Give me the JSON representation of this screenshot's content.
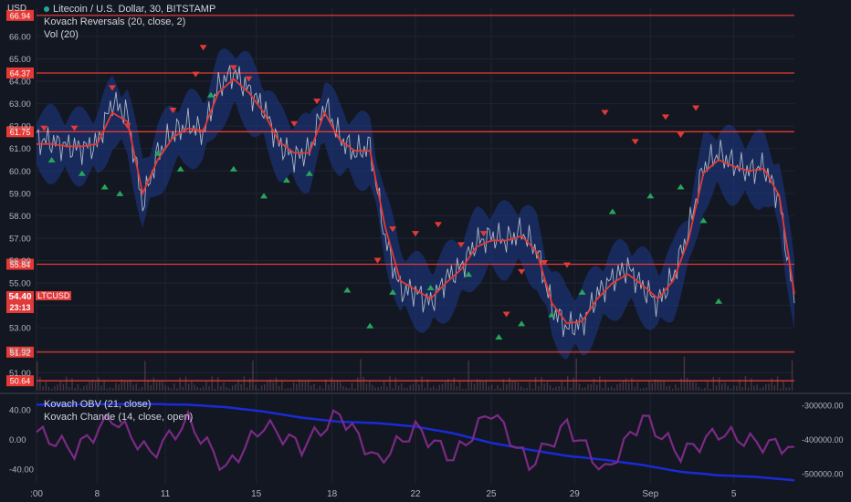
{
  "header": {
    "currency": "USD",
    "title": "Litecoin / U.S. Dollar, 30, BITSTAMP",
    "indicator1": "Kovach Reversals (20, close, 2)",
    "indicator2": "Vol (20)"
  },
  "lower_pane": {
    "indicator1": "Kovach OBV (21, close)",
    "indicator2": "Kovach Chande (14, close, open)"
  },
  "symbol_tag": "LTCUSD",
  "price_tag": "54.40",
  "countdown": "23:13",
  "colors": {
    "background": "#131722",
    "level_line": "#e53935",
    "channel": "#1e3a8a",
    "price": "#c8cfd6",
    "ma": "#e53935",
    "up_marker": "#26a65b",
    "down_marker": "#e53935",
    "obv": "#1a2bd6",
    "chande": "#7b2a84"
  },
  "chart_data": [
    {
      "type": "line",
      "title": "Litecoin / U.S. Dollar, 30, BITSTAMP",
      "yaxis_label": "USD",
      "ylim": [
        50.2,
        67.3
      ],
      "y_ticks": [
        "66.00",
        "65.00",
        "64.00",
        "63.00",
        "62.00",
        "61.00",
        "60.00",
        "59.00",
        "58.00",
        "57.00",
        "56.00",
        "55.00",
        "54.00",
        "53.00",
        "52.00",
        "51.00"
      ],
      "x_ticks": [
        ":00",
        "8",
        "11",
        "15",
        "18",
        "22",
        "25",
        "29",
        "Sep",
        "5"
      ],
      "levels": [
        {
          "value": 66.94,
          "label": "66.94"
        },
        {
          "value": 64.37,
          "label": "64.37"
        },
        {
          "value": 61.75,
          "label": "61.75"
        },
        {
          "value": 55.84,
          "label": "55.84"
        },
        {
          "value": 51.92,
          "label": "51.92"
        },
        {
          "value": 50.64,
          "label": "50.64"
        }
      ],
      "x": [
        0,
        2,
        4,
        6,
        8,
        10,
        12,
        14,
        16,
        18,
        20,
        22,
        24,
        26,
        28,
        30,
        32,
        34,
        36,
        38,
        40,
        42,
        44,
        46,
        48,
        50,
        52,
        54,
        56,
        58,
        60,
        62,
        64,
        66,
        68,
        70,
        72,
        74,
        76,
        78,
        80,
        82,
        84,
        86,
        88,
        90,
        92,
        94,
        96,
        98,
        100
      ],
      "series": [
        {
          "values": [
            61.4,
            61.3,
            61.1,
            61.0,
            61.2,
            63.1,
            62.5,
            58.5,
            60.8,
            61.7,
            62.1,
            61.7,
            63.8,
            64.4,
            63.6,
            62.8,
            61.2,
            60.6,
            60.9,
            63.0,
            61.5,
            60.8,
            61.1,
            57.0,
            54.7,
            54.6,
            54.1,
            55.2,
            55.7,
            56.8,
            57.1,
            56.9,
            57.3,
            56.5,
            53.9,
            53.0,
            53.2,
            54.5,
            55.2,
            55.7,
            54.8,
            54.1,
            55.3,
            57.3,
            60.2,
            60.8,
            60.3,
            60.0,
            60.2,
            58.7,
            54.1
          ]
        },
        {
          "values": [
            61.2,
            61.2,
            61.1,
            61.1,
            61.2,
            62.6,
            62.2,
            59.0,
            60.5,
            61.5,
            61.9,
            61.8,
            63.5,
            64.1,
            63.5,
            62.6,
            61.3,
            60.8,
            60.8,
            62.6,
            61.4,
            60.9,
            60.9,
            57.5,
            55.1,
            54.7,
            54.3,
            55.0,
            55.6,
            56.6,
            56.9,
            56.9,
            57.1,
            56.4,
            54.1,
            53.2,
            53.3,
            54.3,
            55.0,
            55.4,
            54.9,
            54.3,
            55.1,
            56.9,
            59.9,
            60.5,
            60.2,
            60.0,
            60.1,
            58.9,
            54.5
          ]
        }
      ],
      "reversal_markers": {
        "down": [
          [
            1,
            61.9
          ],
          [
            5,
            61.9
          ],
          [
            10,
            63.7
          ],
          [
            12,
            62.0
          ],
          [
            18,
            62.7
          ],
          [
            21,
            64.3
          ],
          [
            22,
            65.5
          ],
          [
            26,
            64.6
          ],
          [
            28,
            64.1
          ],
          [
            34,
            62.1
          ],
          [
            37,
            63.1
          ],
          [
            45,
            56.0
          ],
          [
            47,
            57.4
          ],
          [
            50,
            57.2
          ],
          [
            53,
            57.6
          ],
          [
            56,
            56.7
          ],
          [
            59,
            57.2
          ],
          [
            62,
            53.6
          ],
          [
            64,
            55.5
          ],
          [
            67,
            55.9
          ],
          [
            70,
            55.8
          ],
          [
            75,
            62.6
          ],
          [
            79,
            61.3
          ],
          [
            83,
            62.4
          ],
          [
            85,
            61.6
          ],
          [
            87,
            62.8
          ]
        ],
        "up": [
          [
            2,
            60.5
          ],
          [
            6,
            59.9
          ],
          [
            9,
            59.3
          ],
          [
            11,
            59.0
          ],
          [
            16,
            60.8
          ],
          [
            19,
            60.1
          ],
          [
            23,
            63.4
          ],
          [
            26,
            60.1
          ],
          [
            30,
            58.9
          ],
          [
            33,
            59.6
          ],
          [
            36,
            59.9
          ],
          [
            41,
            54.7
          ],
          [
            44,
            53.1
          ],
          [
            47,
            54.6
          ],
          [
            52,
            54.8
          ],
          [
            57,
            55.4
          ],
          [
            61,
            52.6
          ],
          [
            64,
            53.2
          ],
          [
            68,
            53.6
          ],
          [
            72,
            54.6
          ],
          [
            76,
            58.2
          ],
          [
            81,
            58.9
          ],
          [
            85,
            59.3
          ],
          [
            88,
            57.8
          ],
          [
            90,
            54.2
          ]
        ]
      }
    },
    {
      "type": "line",
      "title": "Kovach OBV (21, close) / Kovach Chande (14, close, open)",
      "left_ticks": [
        "40.00",
        "0.00",
        "-40.00"
      ],
      "right_ticks": [
        "-300000.00",
        "-400000.00",
        "-500000.00"
      ],
      "left_ylim": [
        -60,
        60
      ],
      "right_ylim": [
        -530000,
        -270000
      ],
      "x": [
        0,
        5,
        10,
        15,
        20,
        25,
        30,
        35,
        40,
        45,
        50,
        55,
        60,
        65,
        70,
        75,
        80,
        85,
        90,
        95,
        100
      ],
      "series": [
        {
          "name": "Kovach OBV (21, close)",
          "axis": "right",
          "values": [
            -298000,
            -297000,
            -296000,
            -296000,
            -298000,
            -305000,
            -318000,
            -336000,
            -348000,
            -352000,
            -362000,
            -382000,
            -410000,
            -430000,
            -448000,
            -460000,
            -475000,
            -495000,
            -505000,
            -510000,
            -520000
          ]
        },
        {
          "name": "Kovach Chande (14, close, open)",
          "axis": "left",
          "values": [
            10,
            -15,
            30,
            -20,
            25,
            -40,
            20,
            -10,
            35,
            -30,
            15,
            -25,
            40,
            -35,
            20,
            -45,
            30,
            -20,
            10,
            -5,
            -10
          ]
        }
      ]
    }
  ]
}
